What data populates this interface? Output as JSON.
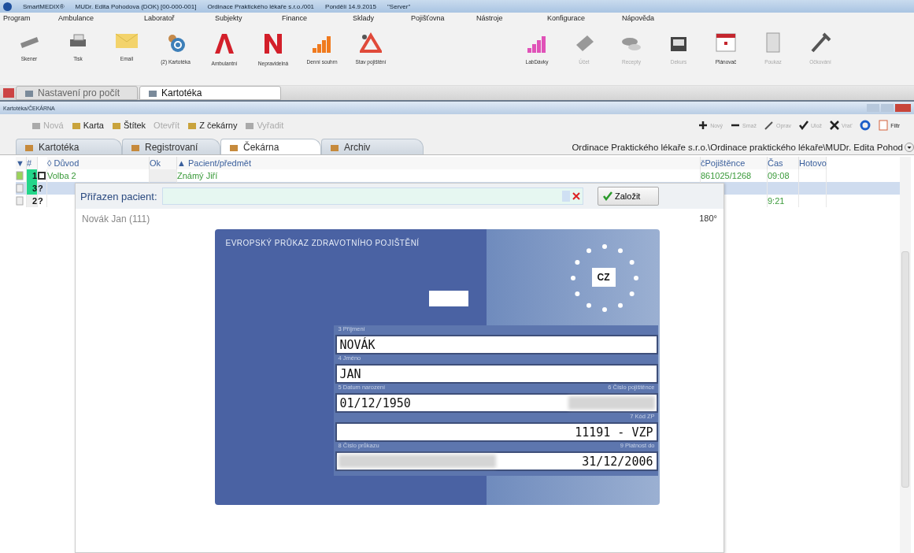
{
  "window": {
    "title_parts": [
      "SmartMEDIX®",
      "MUDr. Edita Pohodova (DOK) [00-000-001]",
      "Ordinace Praktického lékaře s.r.o./001",
      "Pondělí 14.9.2015",
      "\"Server\""
    ]
  },
  "menu": [
    "Program",
    "Ambulance",
    "Laboratoř",
    "Subjekty",
    "Finance",
    "Sklady",
    "Pojišťovna",
    "Nástroje",
    "Konfigurace",
    "Nápověda"
  ],
  "toolbar": [
    {
      "kind": "scanner",
      "label": "Skener",
      "disabled": false
    },
    {
      "kind": "printer",
      "label": "Tisk",
      "disabled": false
    },
    {
      "kind": "mail",
      "label": "Email",
      "disabled": false
    },
    {
      "kind": "people",
      "label": "(2) Kartotéka",
      "disabled": false
    },
    {
      "kind": "letter-a",
      "label": "Ambulantní",
      "disabled": false
    },
    {
      "kind": "letter-n",
      "label": "Nepravidelná",
      "disabled": false
    },
    {
      "kind": "chart",
      "label": "Denní souhrn",
      "disabled": false
    },
    {
      "kind": "query",
      "label": "Stav pojištění",
      "disabled": false
    },
    {
      "kind": "gap"
    },
    {
      "kind": "chart-pink",
      "label": "LabDávky",
      "disabled": false
    },
    {
      "kind": "ticket",
      "label": "Účet",
      "disabled": true
    },
    {
      "kind": "pills",
      "label": "Recepty",
      "disabled": true
    },
    {
      "kind": "bag",
      "label": "Dekurs",
      "disabled": true
    },
    {
      "kind": "calendar",
      "label": "Plánovač",
      "disabled": false
    },
    {
      "kind": "form",
      "label": "Poukaz",
      "disabled": true
    },
    {
      "kind": "syringe",
      "label": "Očkování",
      "disabled": true
    }
  ],
  "doc_tabs": [
    {
      "label": "Nastavení pro počít",
      "selected": false
    },
    {
      "label": "Kartotéka",
      "selected": true
    }
  ],
  "subwindow": {
    "title": "Kartotéka/ČEKÁRNA",
    "actions_left": [
      {
        "label": "Nová",
        "disabled": true
      },
      {
        "label": "Karta",
        "disabled": false
      },
      {
        "label": "Štítek",
        "disabled": false
      },
      {
        "label": "Otevřít",
        "disabled": true
      },
      {
        "label": "Z čekárny",
        "disabled": false
      },
      {
        "label": "Vyřadit",
        "disabled": true
      }
    ],
    "actions_right": [
      {
        "kind": "plus",
        "label": "Nový"
      },
      {
        "kind": "minus",
        "label": "Smaž"
      },
      {
        "kind": "pencil",
        "label": "Oprav"
      },
      {
        "kind": "check",
        "label": "Ulož"
      },
      {
        "kind": "cross",
        "label": "Vrať"
      },
      {
        "kind": "refresh"
      },
      {
        "kind": "filter",
        "label": "Filtr"
      }
    ],
    "tabs": [
      {
        "label": "Kartotéka",
        "selected": false
      },
      {
        "label": "Registrovaní",
        "selected": false
      },
      {
        "label": "Čekárna",
        "selected": true
      },
      {
        "label": "Archiv",
        "selected": false
      }
    ],
    "path": "Ordinace Praktického lékaře s.r.o.\\Ordinace praktického lékaře\\MUDr. Edita Pohod",
    "table": {
      "columns": [
        "▼",
        "#",
        "◊ Důvod",
        "Ok",
        "▲ Pacient/předmět",
        "čPojištěnce",
        "Čas",
        "Hotovo"
      ],
      "rows": [
        {
          "number": "1",
          "reason": "Volba 2",
          "patient": "Známý Jiří",
          "insured": "861025/1268",
          "time": "09:08",
          "present": true,
          "selected": false,
          "highlight": true
        },
        {
          "number": "3",
          "mark": "?",
          "reason": "",
          "patient": "",
          "insured": "",
          "time": "",
          "present": false,
          "selected": true,
          "highlight": true
        },
        {
          "number": "2",
          "mark": "?",
          "reason": "",
          "patient": "",
          "insured": "",
          "time": "9:21",
          "present": false,
          "selected": false,
          "highlight": false
        }
      ]
    }
  },
  "panel": {
    "label": "Přiřazen pacient:",
    "submit": "Založit",
    "patient": "Novák Jan (111)",
    "rotate": "180°",
    "card": {
      "title": "EVROPSKÝ PRŮKAZ ZDRAVOTNÍHO POJIŠTĚNÍ",
      "country": "CZ",
      "rows": [
        {
          "left_label": "3 Příjmení",
          "left_value": "NOVÁK"
        },
        {
          "left_label": "4 Jméno",
          "left_value": "JAN"
        },
        {
          "left_label": "5 Datum narození",
          "right_label": "6 Číslo pojištěnce",
          "left_value": "01/12/1950"
        },
        {
          "right_label": "7 Kód ZP",
          "right_value": "11191 - VZP"
        },
        {
          "left_label": "8 Číslo průkazu",
          "right_label": "9 Platnost do",
          "right_value": "31/12/2006"
        }
      ]
    }
  }
}
